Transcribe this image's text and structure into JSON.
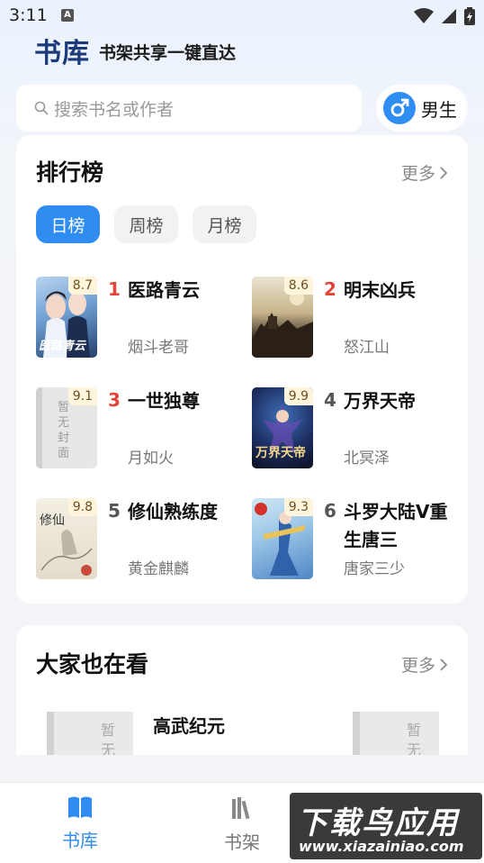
{
  "status_bar": {
    "time": "3:11",
    "badge": "A"
  },
  "header": {
    "title": "书库",
    "subtitle": "书架共享一键直达"
  },
  "search": {
    "placeholder": "搜索书名或作者"
  },
  "gender_toggle": {
    "label": "男生",
    "icon": "male-symbol-icon"
  },
  "ranking": {
    "title": "排行榜",
    "more": "更多",
    "tabs": [
      {
        "label": "日榜",
        "active": true
      },
      {
        "label": "周榜",
        "active": false
      },
      {
        "label": "月榜",
        "active": false
      }
    ],
    "books": [
      {
        "rank": "1",
        "title": "医路青云",
        "author": "烟斗老哥",
        "score": "8.7",
        "cover_text": "医路青云"
      },
      {
        "rank": "2",
        "title": "明末凶兵",
        "author": "怒江山",
        "score": "8.6",
        "cover_text": ""
      },
      {
        "rank": "3",
        "title": "一世独尊",
        "author": "月如火",
        "score": "9.1",
        "cover_text": "暂无封面"
      },
      {
        "rank": "4",
        "title": "万界天帝",
        "author": "北冥泽",
        "score": "9.9",
        "cover_text": "万界天帝"
      },
      {
        "rank": "5",
        "title": "修仙熟练度",
        "author": "黄金麒麟",
        "score": "9.8",
        "cover_text": "修仙"
      },
      {
        "rank": "6",
        "title": "斗罗大陆V重生唐三",
        "author": "唐家三少",
        "score": "9.3",
        "cover_text": ""
      }
    ]
  },
  "recommend": {
    "title": "大家也在看",
    "more": "更多",
    "items": [
      {
        "title": "高武纪元",
        "cover_text": "暂无"
      }
    ],
    "right_cover_text": "暂无"
  },
  "bottom_nav": {
    "items": [
      {
        "label": "书库",
        "active": true,
        "icon": "library-book-icon"
      },
      {
        "label": "书架",
        "active": false,
        "icon": "bookshelf-icon"
      }
    ]
  },
  "watermark": {
    "big": "下载鸟应用",
    "small": "www.xiazainiao.com"
  },
  "colors": {
    "accent": "#2f8cf0",
    "rank_hot": "#e2463b",
    "header_blue": "#1b3a7a"
  }
}
